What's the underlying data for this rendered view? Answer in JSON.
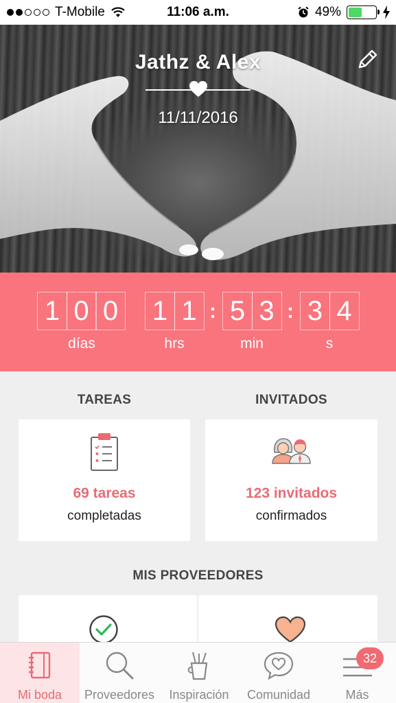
{
  "status_bar": {
    "carrier": "T-Mobile",
    "time": "11:06 a.m.",
    "battery": "49%",
    "battery_level": 0.49
  },
  "hero": {
    "names": "Jathz & Alex",
    "date": "11/11/2016"
  },
  "countdown": {
    "days": [
      "1",
      "0",
      "0"
    ],
    "hours": [
      "1",
      "1"
    ],
    "minutes": [
      "5",
      "3"
    ],
    "seconds": [
      "3",
      "4"
    ],
    "separator": ":",
    "labels": {
      "days": "días",
      "hours": "hrs",
      "minutes": "min",
      "seconds": "s"
    }
  },
  "tasks": {
    "title": "TAREAS",
    "count": "69 tareas",
    "sub": "completadas"
  },
  "guests": {
    "title": "INVITADOS",
    "count": "123 invitados",
    "sub": "confirmados"
  },
  "vendors": {
    "title": "MIS PROVEEDORES"
  },
  "tabs": [
    {
      "label": "Mi boda",
      "icon": "notebook-icon",
      "active": true
    },
    {
      "label": "Proveedores",
      "icon": "search-icon",
      "active": false
    },
    {
      "label": "Inspiración",
      "icon": "pencil-cup-icon",
      "active": false
    },
    {
      "label": "Comunidad",
      "icon": "heart-chat-icon",
      "active": false
    },
    {
      "label": "Más",
      "icon": "menu-icon",
      "active": false,
      "badge": "32"
    }
  ],
  "colors": {
    "accent": "#f9747d",
    "accent_text": "#e86b74",
    "background": "#efefef",
    "battery": "#4cd964"
  }
}
